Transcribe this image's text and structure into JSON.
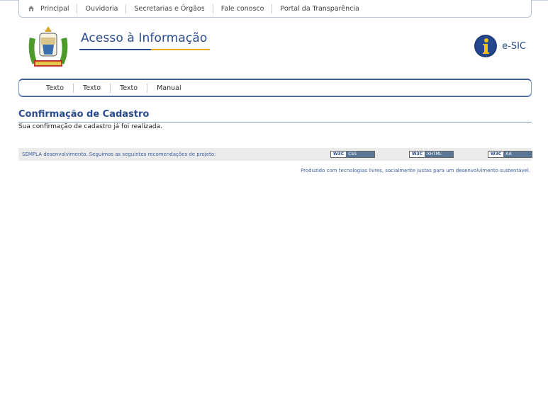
{
  "topnav": {
    "items": [
      "Principal",
      "Ouvidoria",
      "Secretarias e Órgãos",
      "Fale conosco",
      "Portal da Transparência"
    ]
  },
  "header": {
    "title": "Acesso à Informação",
    "esic_label": "e-SIC"
  },
  "subnav": {
    "items": [
      "Texto",
      "Texto",
      "Texto",
      "Manual"
    ]
  },
  "main": {
    "page_title": "Confirmação de Cadastro",
    "message": "Sua confirmação de cadastro já foi realizada."
  },
  "footer": {
    "text": "SEMPLA desenvolvimento. Seguimos as seguintes recomendações de projeto:",
    "badges": [
      {
        "w3": "W3C",
        "std": "CSS"
      },
      {
        "w3": "W3C",
        "std": "XHTML"
      },
      {
        "w3": "W3C",
        "std": "AA"
      }
    ],
    "note": "Produzido com tecnologias livres, socialmente justas para um desenvolvimento sustentável."
  },
  "colors": {
    "brand_blue": "#2a4b8f",
    "accent_gold": "#e6a817",
    "footer_bg": "#ebebeb"
  }
}
